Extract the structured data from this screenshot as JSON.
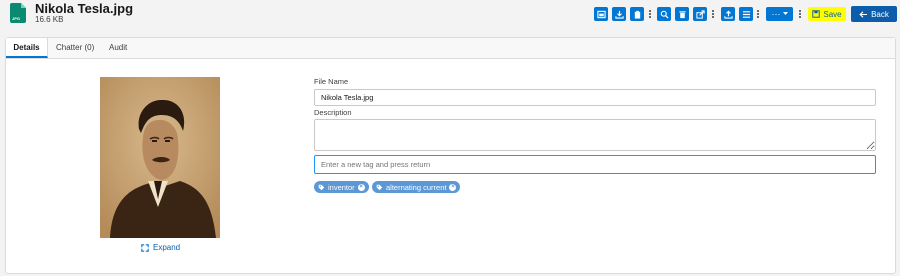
{
  "header": {
    "file_name": "Nikola Tesla.jpg",
    "file_size": "16.6 KB",
    "file_type_icon": "jpg-file-icon",
    "save_label": "Save",
    "back_label": "Back",
    "more_label": "···"
  },
  "tabs": [
    {
      "label": "Details",
      "active": true
    },
    {
      "label": "Chatter (0)",
      "active": false
    },
    {
      "label": "Audit",
      "active": false
    }
  ],
  "preview": {
    "expand_label": "Expand"
  },
  "form": {
    "file_name_label": "File Name",
    "file_name_value": "Nikola Tesla.jpg",
    "description_label": "Description",
    "description_value": "",
    "tag_placeholder": "Enter a new tag and press return",
    "tags": [
      "inventor",
      "alternating current"
    ]
  },
  "colors": {
    "brand": "#0176d3",
    "back_button": "#0b5cab",
    "save_highlight": "#ffff00",
    "tag_pill": "#5c97d6"
  }
}
